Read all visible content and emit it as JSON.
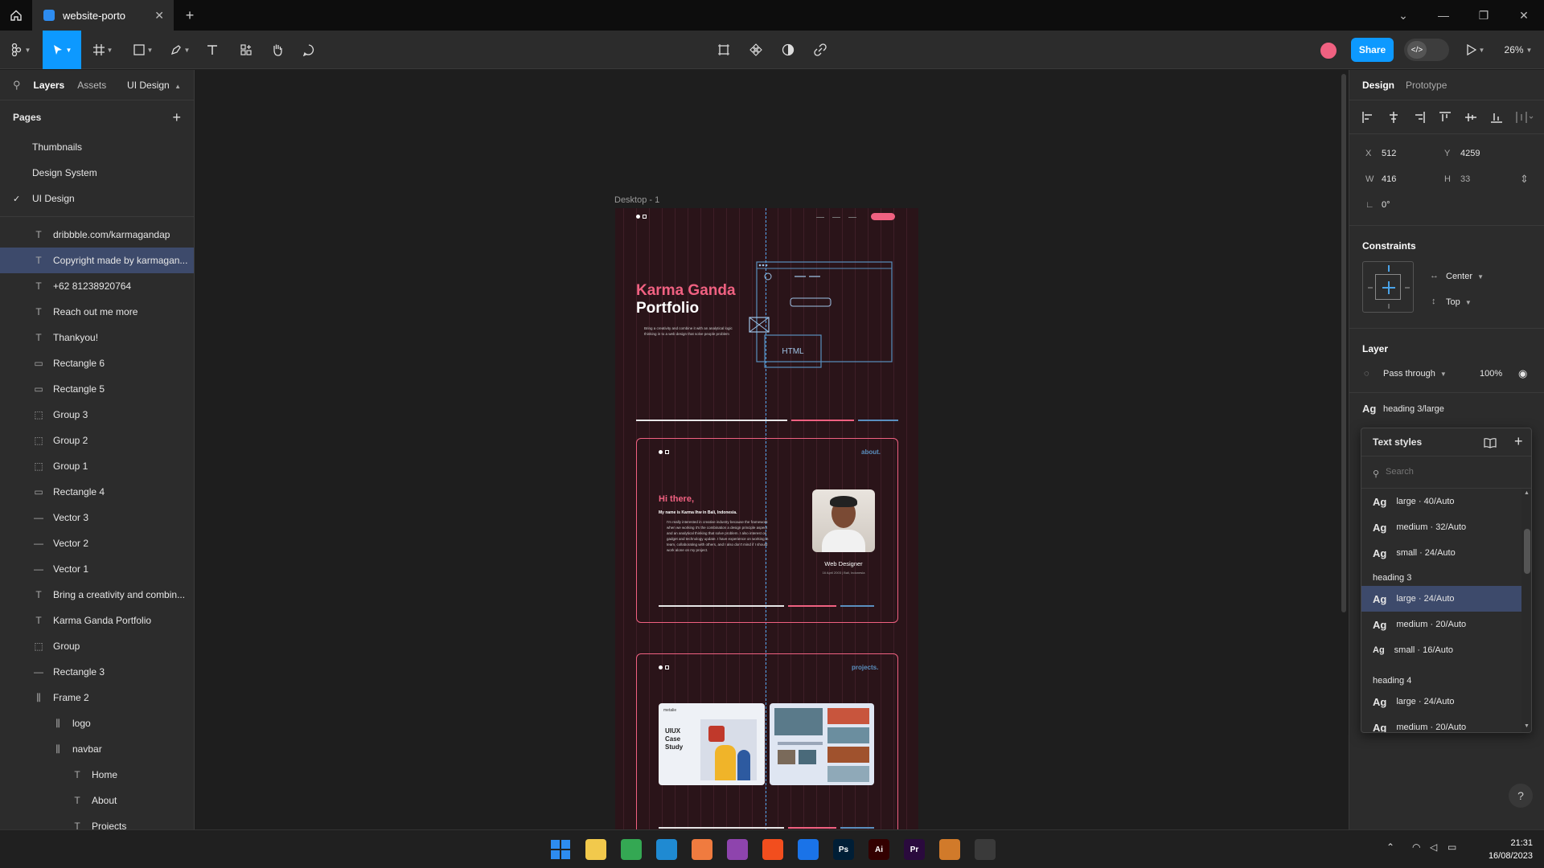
{
  "titlebar": {
    "tab_title": "website-porto"
  },
  "toolbar": {
    "share_label": "Share",
    "zoom": "26%"
  },
  "left_panel": {
    "tabs": [
      "Layers",
      "Assets"
    ],
    "page_selector": "UI Design",
    "pages_heading": "Pages",
    "pages": [
      "Thumbnails",
      "Design System",
      "UI Design"
    ],
    "layers": [
      {
        "name": "dribbble.com/karmagandap",
        "icon": "text-icon",
        "indent": 0
      },
      {
        "name": "Copyright made by karmagan...",
        "icon": "text-icon",
        "indent": 0,
        "selected": true
      },
      {
        "name": "+62 81238920764",
        "icon": "text-icon",
        "indent": 0
      },
      {
        "name": "Reach out me more",
        "icon": "text-icon",
        "indent": 0
      },
      {
        "name": "Thankyou!",
        "icon": "text-icon",
        "indent": 0
      },
      {
        "name": "Rectangle 6",
        "icon": "rectangle-icon",
        "indent": 0
      },
      {
        "name": "Rectangle 5",
        "icon": "rectangle-icon",
        "indent": 0
      },
      {
        "name": "Group 3",
        "icon": "group-icon",
        "indent": 0
      },
      {
        "name": "Group 2",
        "icon": "group-icon",
        "indent": 0
      },
      {
        "name": "Group 1",
        "icon": "group-icon",
        "indent": 0
      },
      {
        "name": "Rectangle 4",
        "icon": "rectangle-icon",
        "indent": 0
      },
      {
        "name": "Vector 3",
        "icon": "vector-icon",
        "indent": 0
      },
      {
        "name": "Vector 2",
        "icon": "vector-icon",
        "indent": 0
      },
      {
        "name": "Vector 1",
        "icon": "vector-icon",
        "indent": 0
      },
      {
        "name": "Bring a creativity and combin...",
        "icon": "text-icon",
        "indent": 0
      },
      {
        "name": "Karma Ganda Portfolio",
        "icon": "text-icon",
        "indent": 0
      },
      {
        "name": "Group",
        "icon": "group-icon",
        "indent": 0
      },
      {
        "name": "Rectangle 3",
        "icon": "vector-icon",
        "indent": 0
      },
      {
        "name": "Frame 2",
        "icon": "frame-icon",
        "indent": 0
      },
      {
        "name": "logo",
        "icon": "frame-icon",
        "indent": 1
      },
      {
        "name": "navbar",
        "icon": "frame-icon",
        "indent": 1
      },
      {
        "name": "Home",
        "icon": "text-icon",
        "indent": 2
      },
      {
        "name": "About",
        "icon": "text-icon",
        "indent": 2
      },
      {
        "name": "Projects",
        "icon": "text-icon",
        "indent": 2
      }
    ]
  },
  "canvas": {
    "frame_label": "Desktop - 1",
    "hero": {
      "title_line1": "Karma Ganda",
      "title_line2": "Portfolio",
      "desc": "Bring a creativity and combine it with an analytical logic thinking in to a web design that solve people problem",
      "html_label": "HTML"
    },
    "about": {
      "tag": "about.",
      "greeting": "Hi there,",
      "intro": "My name is Karma Ihw in Bali, Indonesia.",
      "body": "I'm really interested in creative industry because the framework when we working it's the combination a design principle aspect and an analytical thinking that solve problem. I also interest on gadget and technology update. I have experience on working in team, collaborating with others, and I also don't mind if I should work alone on my project.",
      "role": "Web Designer",
      "birth": "16 April 2003 | Bali, Indonesia"
    },
    "projects": {
      "tag": "projects.",
      "card1_brand": "metalie",
      "card1_title_1": "UIUX",
      "card1_title_2": "Case",
      "card1_title_3": "Study"
    }
  },
  "right_panel": {
    "tabs": [
      "Design",
      "Prototype"
    ],
    "x_label": "X",
    "x_value": "512",
    "y_label": "Y",
    "y_value": "4259",
    "w_label": "W",
    "w_value": "416",
    "h_label": "H",
    "h_value": "33",
    "rotation": "0°",
    "constraints_heading": "Constraints",
    "constraint_h": "Center",
    "constraint_v": "Top",
    "layer_heading": "Layer",
    "blend_mode": "Pass through",
    "opacity": "100%",
    "text_style_ag": "Ag",
    "text_style_name": "heading 3/large"
  },
  "text_styles_popup": {
    "heading": "Text styles",
    "search_placeholder": "Search",
    "ag": "Ag",
    "group_heading3": "heading 3",
    "group_heading4": "heading 4",
    "rows": [
      {
        "label": "large · 40/Auto"
      },
      {
        "label": "medium · 32/Auto"
      },
      {
        "label": "small · 24/Auto"
      },
      {
        "label": "large · 24/Auto",
        "selected": true
      },
      {
        "label": "medium · 20/Auto"
      },
      {
        "label": "small · 16/Auto"
      },
      {
        "label": "large · 24/Auto"
      },
      {
        "label": "medium · 20/Auto"
      }
    ]
  },
  "taskbar": {
    "time": "21:31",
    "date": "16/08/2023",
    "apps": [
      {
        "name": "windows-start-icon",
        "color": "#2d8cf0",
        "label": ""
      },
      {
        "name": "file-explorer-icon",
        "color": "#f2c94c",
        "label": ""
      },
      {
        "name": "chrome-icon",
        "color": "#34a853",
        "label": ""
      },
      {
        "name": "vscode-icon",
        "color": "#1f8ad2",
        "label": ""
      },
      {
        "name": "xampp-icon",
        "color": "#f07b3f",
        "label": ""
      },
      {
        "name": "github-desktop-icon",
        "color": "#8e44ad",
        "label": ""
      },
      {
        "name": "figma-icon",
        "color": "#f24e1e",
        "label": ""
      },
      {
        "name": "framer-icon",
        "color": "#1a73e8",
        "label": ""
      },
      {
        "name": "photoshop-icon",
        "color": "#001e36",
        "label": "Ps"
      },
      {
        "name": "illustrator-icon",
        "color": "#330000",
        "label": "Ai"
      },
      {
        "name": "premiere-icon",
        "color": "#2a0a3d",
        "label": "Pr"
      },
      {
        "name": "media-player-icon",
        "color": "#d17a2a",
        "label": ""
      },
      {
        "name": "calculator-icon",
        "color": "#3a3a3a",
        "label": ""
      }
    ]
  }
}
